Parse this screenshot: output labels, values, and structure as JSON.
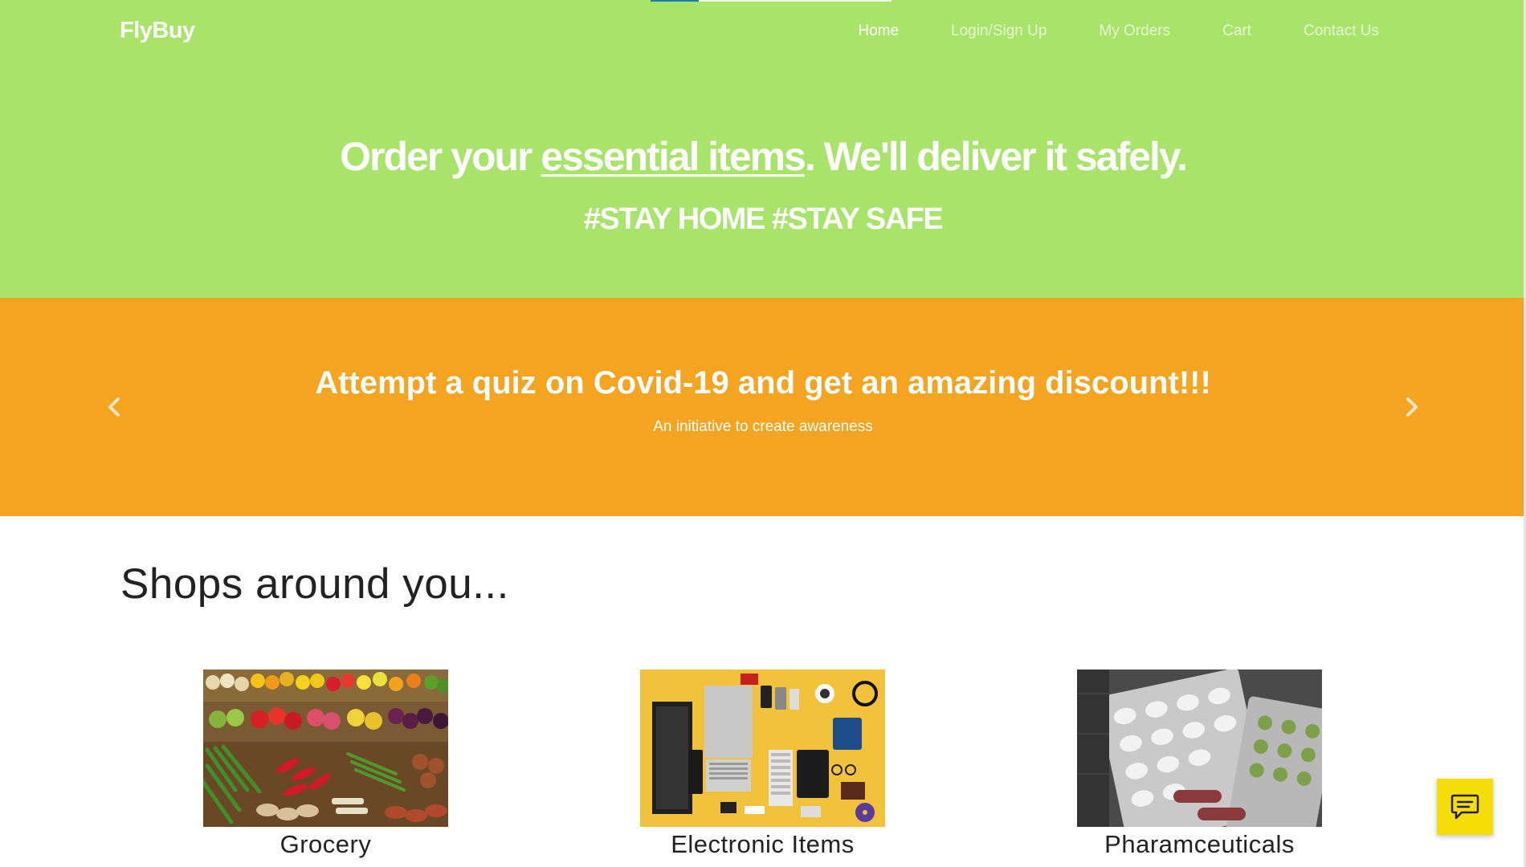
{
  "navbar": {
    "brand": "FlyBuy",
    "links": [
      {
        "label": "Home",
        "active": true
      },
      {
        "label": "Login/Sign Up",
        "active": false
      },
      {
        "label": "My Orders",
        "active": false
      },
      {
        "label": "Cart",
        "active": false
      },
      {
        "label": "Contact Us",
        "active": false
      }
    ]
  },
  "hero": {
    "title_before": "Order your ",
    "title_highlight": "essential items",
    "title_after": ". We'll deliver it safely.",
    "subtitle": "#STAY HOME #STAY SAFE"
  },
  "carousel": {
    "heading": "Attempt a quiz on Covid-19 and get an amazing discount!!!",
    "caption": "An initiative to create awareness",
    "prev_icon": "chevron-left-icon",
    "next_icon": "chevron-right-icon"
  },
  "shops": {
    "heading": "Shops around you...",
    "items": [
      {
        "label": "Grocery",
        "image": "grocery-image"
      },
      {
        "label": "Electronic Items",
        "image": "electronics-image"
      },
      {
        "label": "Pharamceuticals",
        "image": "pharmaceuticals-image"
      }
    ]
  },
  "chat": {
    "icon": "chat-icon"
  },
  "colors": {
    "hero_bg": "#a8e36a",
    "carousel_bg": "#f4a420",
    "chat_bg": "#f5dd08",
    "text_dark": "#222222"
  }
}
